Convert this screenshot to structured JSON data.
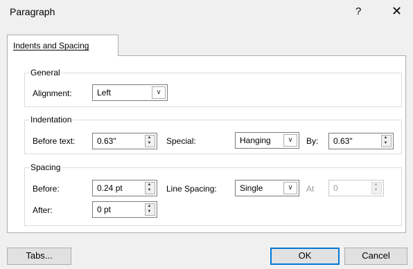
{
  "dialog": {
    "title": "Paragraph",
    "help": "?",
    "close": "✕"
  },
  "tab": {
    "label": "Indents and Spacing"
  },
  "general": {
    "title": "General",
    "alignment_label": "Alignment:",
    "alignment_value": "Left"
  },
  "indentation": {
    "title": "Indentation",
    "before_text_label": "Before text:",
    "before_text_value": "0.63\"",
    "special_label": "Special:",
    "special_value": "Hanging",
    "by_label": "By:",
    "by_value": "0.63\""
  },
  "spacing": {
    "title": "Spacing",
    "before_label": "Before:",
    "before_value": "0.24 pt",
    "after_label": "After:",
    "after_value": "0 pt",
    "line_spacing_label": "Line Spacing:",
    "line_spacing_value": "Single",
    "at_label": "At",
    "at_value": "0"
  },
  "buttons": {
    "tabs": "Tabs...",
    "ok": "OK",
    "cancel": "Cancel"
  }
}
